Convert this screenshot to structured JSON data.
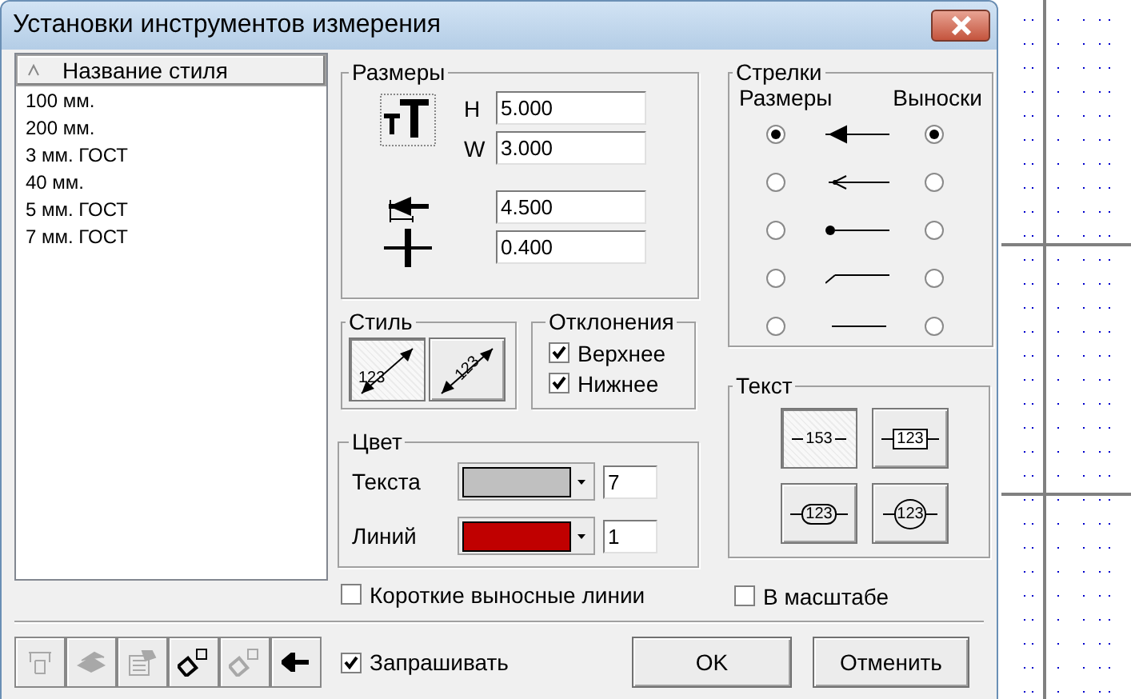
{
  "window": {
    "title": "Установки инструментов измерения"
  },
  "styles_list": {
    "header": "Название стиля",
    "items": [
      "100 мм.",
      "200 мм.",
      "3 мм. ГОСТ",
      "40 мм.",
      "5 мм. ГОСТ",
      "7 мм. ГОСТ"
    ]
  },
  "dimensions": {
    "title": "Размеры",
    "fields": [
      {
        "kind": "height",
        "label": "H",
        "value": "5.000"
      },
      {
        "kind": "width",
        "label": "W",
        "value": "3.000"
      },
      {
        "kind": "arrow",
        "value": "4.500"
      },
      {
        "kind": "gap",
        "value": "0.400"
      }
    ]
  },
  "style": {
    "title": "Стиль",
    "options": [
      {
        "kind": "along",
        "label": "123",
        "selected": true
      },
      {
        "kind": "rotated",
        "label": "123",
        "selected": false
      }
    ]
  },
  "deviations": {
    "title": "Отклонения",
    "options": [
      {
        "label": "Верхнее",
        "checked": true
      },
      {
        "label": "Нижнее",
        "checked": true
      }
    ]
  },
  "color": {
    "title": "Цвет",
    "rows": [
      {
        "label": "Текста",
        "color": "#c0c0c0",
        "number": "7"
      },
      {
        "label": "Линий",
        "color": "#c00000",
        "number": "1"
      }
    ]
  },
  "short_lines": {
    "label": "Короткие выносные линии",
    "checked": false
  },
  "arrows": {
    "title": "Стрелки",
    "column_1": "Размеры",
    "column_2": "Выноски",
    "rows": [
      {
        "kind": "filled",
        "dimension_selected": true,
        "leader_selected": true
      },
      {
        "kind": "open",
        "dimension_selected": false,
        "leader_selected": false
      },
      {
        "kind": "dot",
        "dimension_selected": false,
        "leader_selected": false
      },
      {
        "kind": "tick",
        "dimension_selected": false,
        "leader_selected": false
      },
      {
        "kind": "none",
        "dimension_selected": false,
        "leader_selected": false
      }
    ]
  },
  "text": {
    "title": "Текст",
    "options": [
      {
        "kind": "plain",
        "label": "153",
        "selected": true
      },
      {
        "kind": "box",
        "label": "123",
        "selected": false
      },
      {
        "kind": "rounded",
        "label": "123",
        "selected": false
      },
      {
        "kind": "circle",
        "label": "123",
        "selected": false
      }
    ]
  },
  "scale": {
    "label": "В масштабе",
    "checked": false
  },
  "toolbar": [
    {
      "kind": "pick",
      "disabled": true
    },
    {
      "kind": "layers",
      "disabled": true
    },
    {
      "kind": "properties",
      "disabled": true
    },
    {
      "kind": "copy",
      "disabled": false
    },
    {
      "kind": "paste",
      "disabled": true
    },
    {
      "kind": "back",
      "disabled": false
    }
  ],
  "ask": {
    "label": "Запрашивать",
    "checked": true
  },
  "buttons": [
    "OK",
    "Отменить"
  ]
}
